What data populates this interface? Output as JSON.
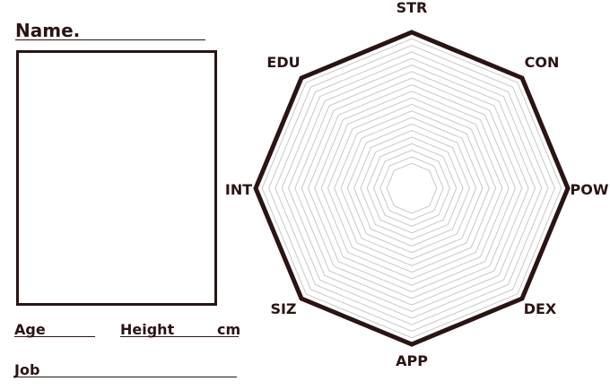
{
  "form": {
    "name_label": "Name.",
    "age_label": "Age",
    "height_label": "Height",
    "height_unit": "cm",
    "job_label": "Job"
  },
  "radar": {
    "axes": [
      "STR",
      "CON",
      "POW",
      "DEX",
      "APP",
      "SIZ",
      "INT",
      "EDU"
    ],
    "grid_levels": 20,
    "colors": {
      "outline": "#2a1414",
      "grid": "#c8c8c8",
      "text": "#2a1414"
    }
  }
}
